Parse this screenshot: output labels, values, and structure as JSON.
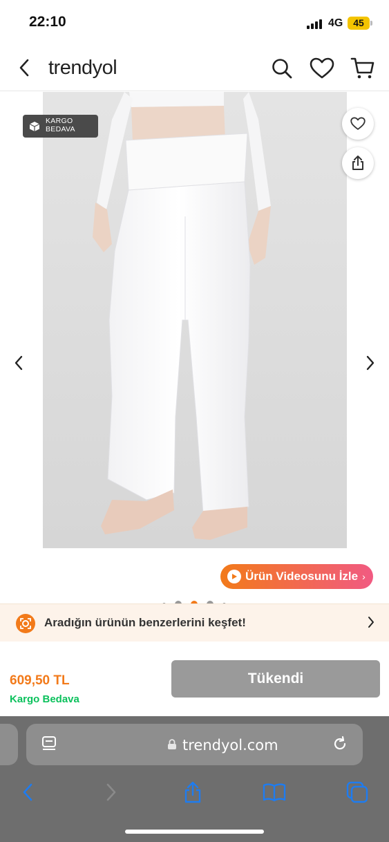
{
  "status_bar": {
    "time": "22:10",
    "network": "4G",
    "battery": "45"
  },
  "header": {
    "logo": "trendyol",
    "icons": [
      "back-icon",
      "search-icon",
      "heart-icon",
      "cart-icon"
    ]
  },
  "product": {
    "badge_line1": "KARGO",
    "badge_line2": "BEDAVA",
    "video_button": "Ürün Videosunu İzle",
    "image_count": 5,
    "active_image": 3
  },
  "similar_banner": {
    "text": "Aradığın ürünün benzerlerini keşfet!"
  },
  "purchase": {
    "price": "609,50 TL",
    "shipping": "Kargo Bedava",
    "button": "Tükendi"
  },
  "browser": {
    "url": "trendyol.com"
  },
  "colors": {
    "brand_orange": "#f27a1a",
    "green": "#0bc15c",
    "ios_blue": "#1e7cf0"
  }
}
